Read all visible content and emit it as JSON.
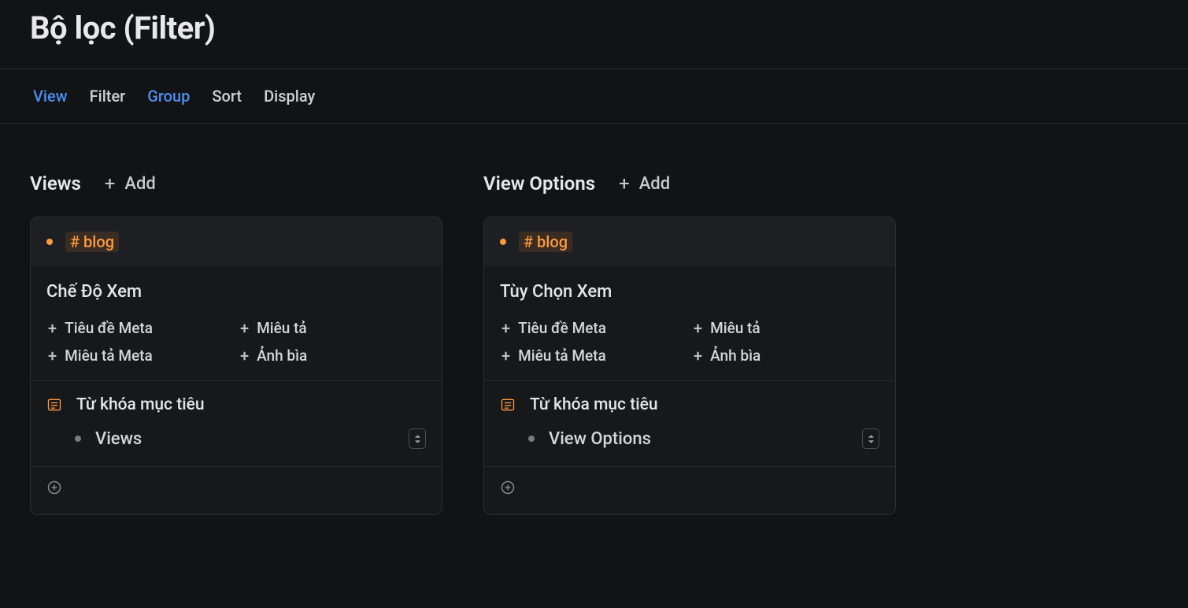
{
  "header": {
    "title": "Bộ lọc (Filter)"
  },
  "tabs": [
    {
      "label": "View",
      "active": true
    },
    {
      "label": "Filter",
      "active": false
    },
    {
      "label": "Group",
      "active": true
    },
    {
      "label": "Sort",
      "active": false
    },
    {
      "label": "Display",
      "active": false
    }
  ],
  "add_label": "Add",
  "sections": [
    {
      "title": "Views",
      "badge": "# blog",
      "subtitle": "Chế Độ Xem",
      "chips": [
        "Tiêu đề Meta",
        "Miêu tả",
        "Miêu tả Meta",
        "Ảnh bìa"
      ],
      "keyword_label": "Từ khóa mục tiêu",
      "select_value": "Views"
    },
    {
      "title": "View Options",
      "badge": "# blog",
      "subtitle": "Tùy Chọn Xem",
      "chips": [
        "Tiêu đề Meta",
        "Miêu tả",
        "Miêu tả Meta",
        "Ảnh bìa"
      ],
      "keyword_label": "Từ khóa mục tiêu",
      "select_value": "View Options"
    }
  ]
}
